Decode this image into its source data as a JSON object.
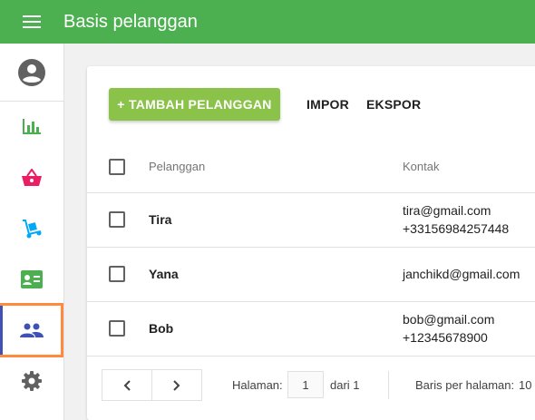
{
  "app": {
    "title": "Basis pelanggan",
    "accent": "#4caf50"
  },
  "sidebar": {
    "items": [
      {
        "name": "account",
        "icon": "account-circle-icon"
      },
      {
        "name": "reports",
        "icon": "bar-chart-icon",
        "color": "#4caf50"
      },
      {
        "name": "sales",
        "icon": "shopping-basket-icon",
        "color": "#e91e63"
      },
      {
        "name": "delivery",
        "icon": "dolly-icon",
        "color": "#03a9f4"
      },
      {
        "name": "contacts",
        "icon": "contact-card-icon",
        "color": "#4caf50"
      },
      {
        "name": "customers",
        "icon": "people-icon",
        "color": "#3f51b5",
        "active": true
      },
      {
        "name": "settings",
        "icon": "gear-icon",
        "color": "#616161"
      }
    ]
  },
  "toolbar": {
    "add_label": "+ TAMBAH PELANGGAN",
    "import_label": "IMPOR",
    "export_label": "EKSPOR"
  },
  "table": {
    "headers": {
      "customer": "Pelanggan",
      "contact": "Kontak"
    },
    "rows": [
      {
        "name": "Tira",
        "email": "tira@gmail.com",
        "phone": "+33156984257448"
      },
      {
        "name": "Yana",
        "email": "janchikd@gmail.com",
        "phone": ""
      },
      {
        "name": "Bob",
        "email": "bob@gmail.com",
        "phone": "+12345678900"
      }
    ]
  },
  "pagination": {
    "page_label": "Halaman:",
    "page_value": "1",
    "of_label": "dari 1",
    "rows_label": "Baris per halaman:",
    "rows_value": "10"
  }
}
